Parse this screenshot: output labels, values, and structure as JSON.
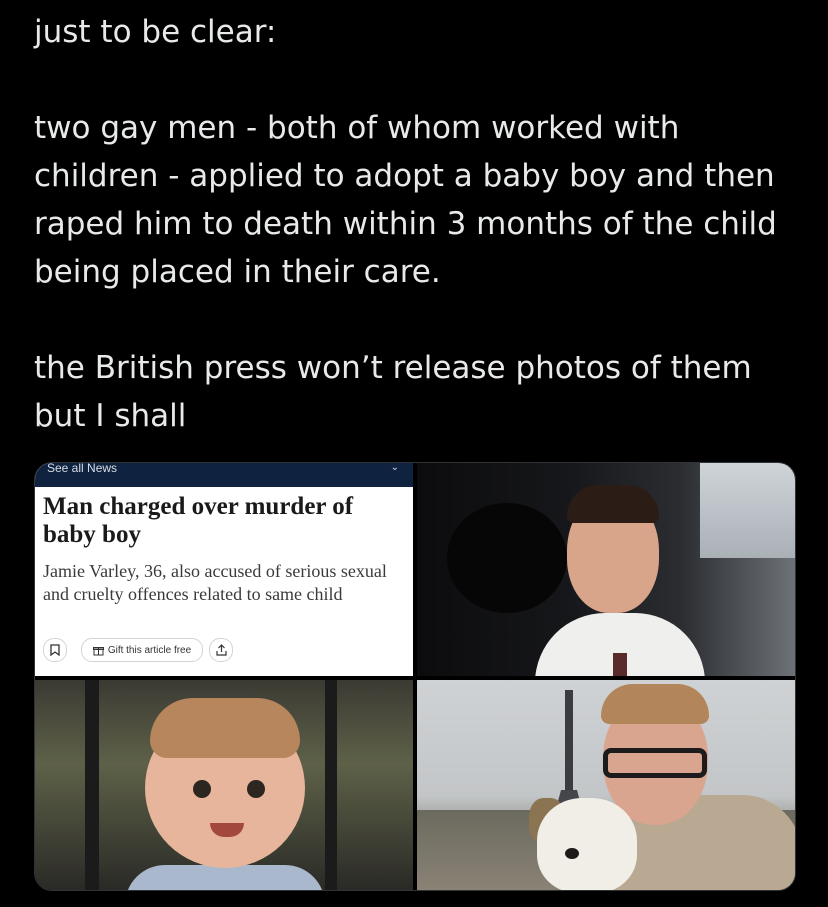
{
  "post": {
    "paragraphs": [
      "just to be clear:",
      "two gay men - both of whom worked with children - applied to adopt a baby boy and then raped him to death within 3 months of the child being placed in their care.",
      "the British press won’t release photos of them but I shall"
    ]
  },
  "media": {
    "article": {
      "nav_label": "See all News",
      "headline": "Man charged over murder of baby boy",
      "standfirst": "Jamie Varley, 36, also accused of serious sexual and cruelty offences related to same child",
      "gift_label": "Gift this article free",
      "icons": [
        "bookmark-icon",
        "gift-icon",
        "share-icon",
        "chevron-down-icon"
      ]
    }
  }
}
